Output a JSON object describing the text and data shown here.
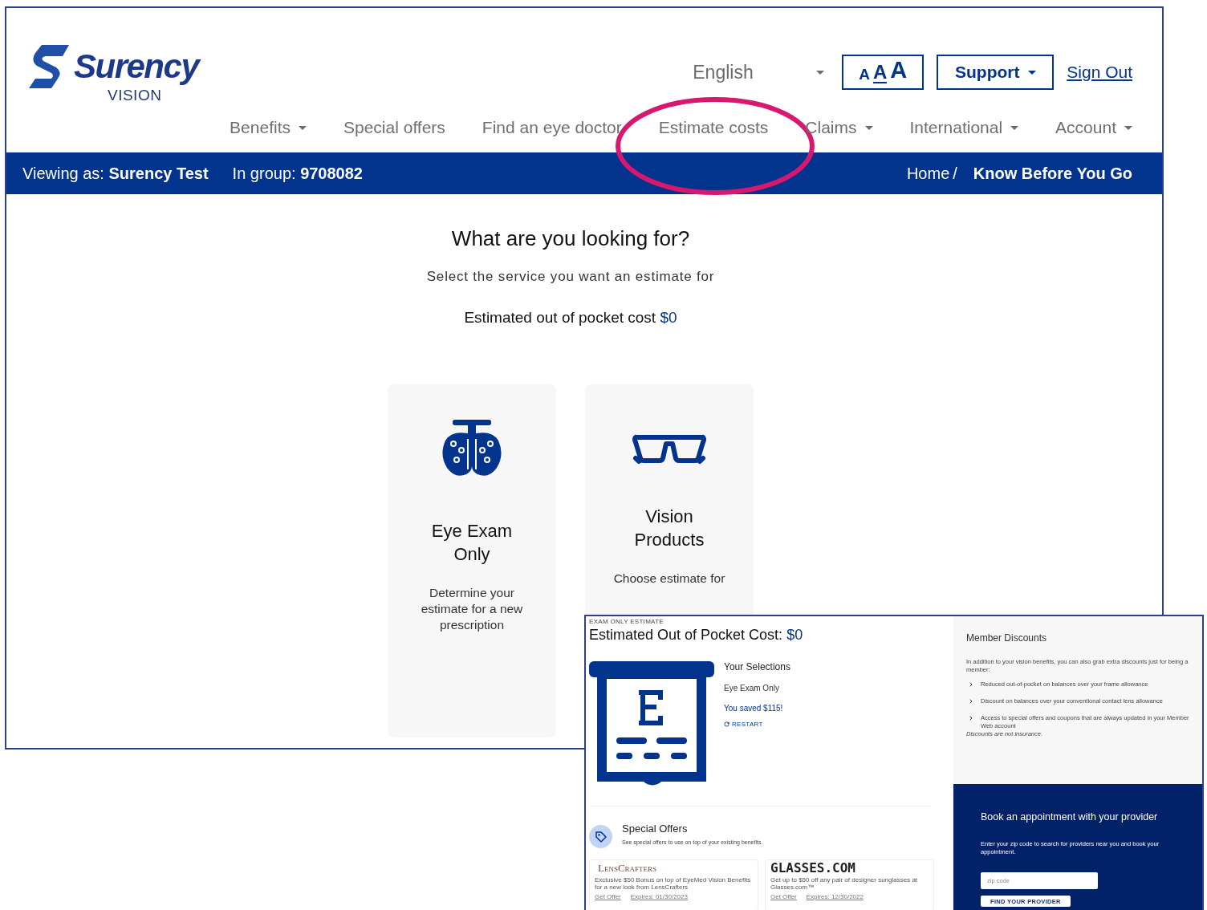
{
  "logo": {
    "name": "Surency",
    "subtitle": "VISION"
  },
  "language": {
    "value": "English"
  },
  "text_sizes": [
    {
      "label": "A",
      "selected": false
    },
    {
      "label": "A",
      "selected": true
    },
    {
      "label": "A",
      "selected": false
    }
  ],
  "support_button": {
    "label": "Support"
  },
  "sign_out": {
    "label": "Sign Out"
  },
  "nav": [
    {
      "label": "Benefits",
      "dropdown": true
    },
    {
      "label": "Special offers",
      "dropdown": false
    },
    {
      "label": "Find an eye doctor",
      "dropdown": false
    },
    {
      "label": "Estimate costs",
      "dropdown": false,
      "circled": true
    },
    {
      "label": "Claims",
      "dropdown": true
    },
    {
      "label": "International",
      "dropdown": true
    },
    {
      "label": "Account",
      "dropdown": true
    }
  ],
  "context_bar": {
    "viewing_label": "Viewing as:",
    "viewing_value": "Surency Test",
    "group_label": "In group:",
    "group_value": "9708082",
    "breadcrumb": [
      {
        "label": "Home",
        "current": false
      },
      {
        "label": "Know Before You Go",
        "current": true
      }
    ],
    "separator": "/"
  },
  "heading": "What are you looking for?",
  "subtitle": "Select the service you want an estimate for",
  "cost": {
    "label": "Estimated out of pocket cost",
    "value": "$0"
  },
  "services": [
    {
      "kind": "exam",
      "title": "Eye Exam Only",
      "description": "Determine your estimate for a new prescription"
    },
    {
      "kind": "glasses",
      "title": "Vision Products",
      "description": "Choose estimate for"
    }
  ],
  "estimate_panel": {
    "eyebrow": "EXAM ONLY ESTIMATE",
    "title": "Estimated Out of Pocket Cost:",
    "value": "$0",
    "selections": {
      "heading": "Your Selections",
      "items": [
        "Eye Exam Only"
      ],
      "savings": "You saved $115!",
      "restart": "RESTART"
    },
    "special_offers": {
      "title": "Special Offers",
      "description": "See special offers to use on top of your existing benefits.",
      "offers": [
        {
          "kind": "lenscrafters",
          "brand": "LensCrafters",
          "description": "Exclusive $50 Bonus on top of EyeMed Vision Benefits for a new look from LensCrafters",
          "link": "Get Offer",
          "expires": "Expires: 01/30/2023"
        },
        {
          "kind": "glassescom",
          "brand": "GLASSES.COM",
          "description": "Get up to $50 off any pair of designer sunglasses at Glasses.com™",
          "link": "Get Offer",
          "expires": "Expires: 12/30/2022"
        }
      ]
    }
  },
  "member_discounts": {
    "title": "Member Discounts",
    "intro": "In addition to your vision benefits, you can also grab extra discounts just for being a member:",
    "items": [
      "Reduced out-of-pocket on balances over your frame allowance",
      "Discount on balances over your conventional contact lens allowance",
      "Access to special offers and coupons that are always updated in your Member Web account"
    ],
    "note": "Discounts are not insurance."
  },
  "booking": {
    "title": "Book an appointment with your provider",
    "description": "Enter your zip code to search for providers near you and book your appointment.",
    "placeholder": "zip code",
    "button": "FIND YOUR PROVIDER"
  }
}
